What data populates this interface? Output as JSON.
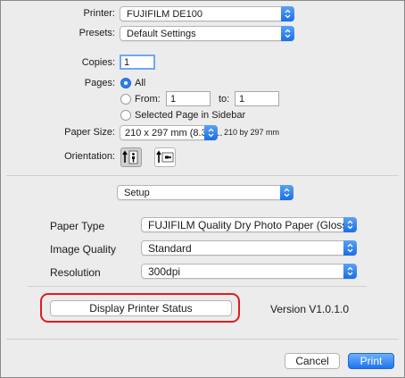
{
  "printer": {
    "label": "Printer:",
    "value": "FUJIFILM DE100"
  },
  "presets": {
    "label": "Presets:",
    "value": "Default Settings"
  },
  "copies": {
    "label": "Copies:",
    "value": "1"
  },
  "pages": {
    "label": "Pages:",
    "all_label": "All",
    "from_label": "From:",
    "from_value": "1",
    "to_label": "to:",
    "to_value": "1",
    "selected_label": "Selected Page in Sidebar",
    "selected_option": "All"
  },
  "paper_size": {
    "label": "Paper Size:",
    "value": "210 x 297 mm (8.3 x...",
    "note": "210 by 297 mm"
  },
  "orientation": {
    "label": "Orientation:",
    "selected": "portrait"
  },
  "section_menu": {
    "value": "Setup"
  },
  "paper_type": {
    "label": "Paper Type",
    "value": "FUJIFILM Quality Dry Photo Paper (Glossy)"
  },
  "image_quality": {
    "label": "Image Quality",
    "value": "Standard"
  },
  "resolution": {
    "label": "Resolution",
    "value": "300dpi"
  },
  "status_button": {
    "label": "Display Printer Status"
  },
  "version": {
    "text": "Version V1.0.1.0"
  },
  "footer": {
    "cancel_label": "Cancel",
    "print_label": "Print"
  },
  "colors": {
    "accent": "#2f7ff0",
    "highlight": "#e01b22",
    "dialog_bg": "#ececec"
  }
}
